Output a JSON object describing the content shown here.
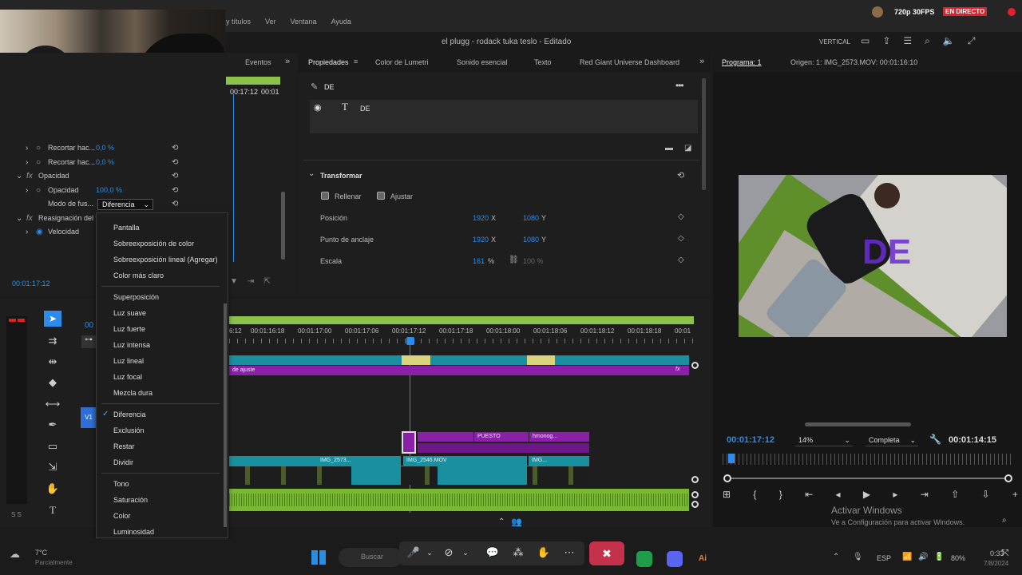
{
  "stream": {
    "quality": "720p 30FPS",
    "live": "EN DIRECTO"
  },
  "menubar": {
    "items": [
      "y títulos",
      "Ver",
      "Ventana",
      "Ayuda"
    ]
  },
  "title": {
    "project": "el plugg - rodack tuka teslo - Editado",
    "workspace": "VERTICAL"
  },
  "left_panel": {
    "tab_events": "Eventos",
    "tc_mini": "00:17:12",
    "tc_mini2": "00:01",
    "rows": [
      {
        "label": "Recortar hac...",
        "value": "0,0 %"
      },
      {
        "label": "Recortar hac...",
        "value": "0,0 %"
      },
      {
        "label": "Opacidad",
        "value": ""
      },
      {
        "label": "Opacidad",
        "value": "100,0 %"
      },
      {
        "label": "Modo de fus...",
        "value": "Diferencia"
      },
      {
        "label": "Reasignación del t",
        "value": ""
      },
      {
        "label": "Velocidad",
        "value": ""
      }
    ],
    "timecode": "00:01:17:12"
  },
  "blend_menu": {
    "groups": [
      [
        "Pantalla",
        "Sobreexposición de color",
        "Sobreexposición lineal (Agregar)",
        "Color más claro"
      ],
      [
        "Superposición",
        "Luz suave",
        "Luz fuerte",
        "Luz intensa",
        "Luz lineal",
        "Luz focal",
        "Mezcla dura"
      ],
      [
        "Diferencia",
        "Exclusión",
        "Restar",
        "Dividir"
      ],
      [
        "Tono",
        "Saturación",
        "Color",
        "Luminosidad"
      ]
    ],
    "checked": "Diferencia"
  },
  "props": {
    "tabs": [
      "Propiedades",
      "Color de Lumetri",
      "Sonido esencial",
      "Texto",
      "Red Giant Universe Dashboard"
    ],
    "layer_title": "DE",
    "text_layer": "DE",
    "transform": "Transformar",
    "fill": "Rellenar",
    "adjust": "Ajustar",
    "position_label": "Posición",
    "position_x": "1920",
    "position_y": "1080",
    "anchor_label": "Punto de anclaje",
    "anchor_x": "1920",
    "anchor_y": "1080",
    "scale_label": "Escala",
    "scale_value": "161",
    "scale_unit": "%",
    "scale_value2": "100 %",
    "x_unit": "X",
    "y_unit": "Y"
  },
  "program": {
    "tab": "Programa: 1",
    "source": "Origen: 1: IMG_2573.MOV: 00:01:16:10",
    "overlay_text": "DE",
    "timecode": "00:01:17:12",
    "zoom": "14%",
    "quality": "Completa",
    "duration": "00:01:14:15"
  },
  "timeline": {
    "ruler": [
      "6:12",
      "00:01:16:18",
      "00:01:17:00",
      "00:01:17:06",
      "00:01:17:12",
      "00:01:17:18",
      "00:01:18:00",
      "00:01:18:06",
      "00:01:18:12",
      "00:01:18:18",
      "00:01"
    ],
    "adjust_label": "de ajuste",
    "track_v1": "V1",
    "clips": {
      "puesto": "PUESTO",
      "hmonog": "hmonog...",
      "img2573": "IMG_2573...",
      "img2546": "IMG_2546.MOV",
      "img": "IMG..."
    },
    "left_tc": "00",
    "meter": "S S"
  },
  "windows": {
    "activate_title": "Activar Windows",
    "activate_sub": "Ve a Configuración para activar Windows."
  },
  "taskbar": {
    "weather": "7°C",
    "weather_sub": "Parcialmente",
    "search": "Buscar",
    "lang": "ESP",
    "battery": "80%",
    "clock": "0:33",
    "date": "7/8/2024"
  },
  "colors": {
    "accent": "#2d8ceb",
    "live": "#e4202c",
    "purple": "#8a1fa8",
    "teal": "#1a8fa0",
    "green": "#79b832"
  }
}
